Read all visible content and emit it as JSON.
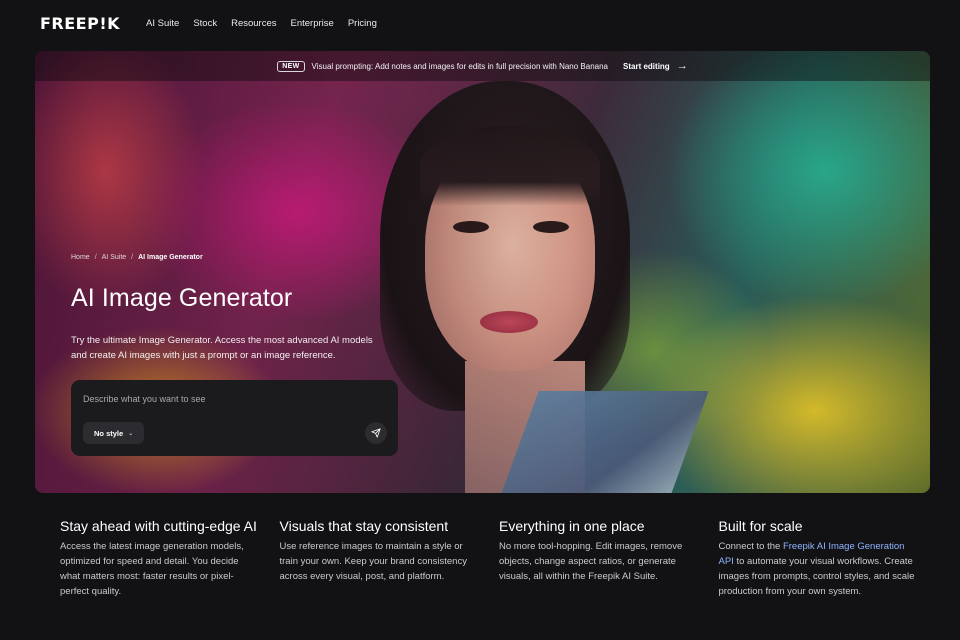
{
  "nav": {
    "logo": "FREEP!K",
    "links": [
      "AI Suite",
      "Stock",
      "Resources",
      "Enterprise",
      "Pricing"
    ]
  },
  "banner": {
    "badge": "NEW",
    "text": "Visual prompting: Add notes and images for edits in full precision with Nano Banana",
    "cta": "Start editing",
    "arrow": "→"
  },
  "breadcrumb": {
    "items": [
      "Home",
      "AI Suite",
      "AI Image Generator"
    ],
    "separator": "/"
  },
  "hero": {
    "title": "AI Image Generator",
    "description": "Try the ultimate Image Generator. Access the most advanced AI models and create AI images with just a prompt or an image reference."
  },
  "prompt": {
    "placeholder": "Describe what you want to see",
    "style_label": "No style",
    "chevron": "⌄"
  },
  "features": [
    {
      "title": "Stay ahead with cutting-edge AI",
      "body": "Access the latest image generation models, optimized for speed and detail. You decide what matters most: faster results or pixel-perfect quality."
    },
    {
      "title": "Visuals that stay consistent",
      "body": "Use reference images to maintain a style or train your own. Keep your brand consistency across every visual, post, and platform."
    },
    {
      "title": "Everything in one place",
      "body": "No more tool-hopping. Edit images, remove objects, change aspect ratios, or generate visuals, all within the Freepik AI Suite."
    },
    {
      "title": "Built for scale",
      "body_before": "Connect to the ",
      "link": "Freepik AI Image Generation API",
      "body_after": " to automate your visual workflows. Create images from prompts, control styles, and scale production from your own system."
    }
  ],
  "colors": {
    "background": "#121114",
    "panel": "#1b1a1d",
    "link": "#8fb4ff"
  }
}
